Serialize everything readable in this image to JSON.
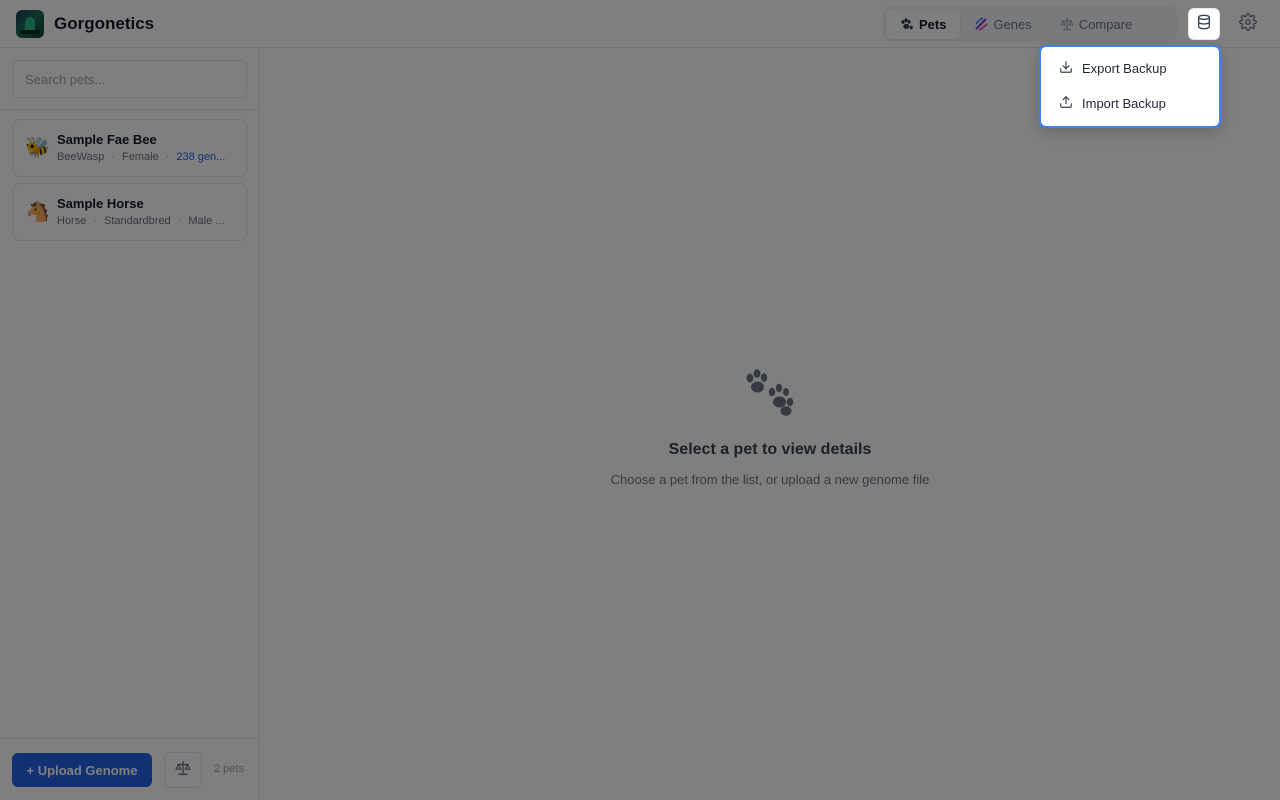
{
  "app": {
    "title": "Gorgonetics"
  },
  "nav": {
    "tabs": [
      {
        "label": "Pets",
        "icon": "paw-icon",
        "active": true
      },
      {
        "label": "Genes",
        "icon": "dna-icon",
        "active": false
      },
      {
        "label": "Compare",
        "icon": "scale-icon",
        "active": false
      }
    ],
    "backup_icon": "database-icon",
    "settings_icon": "gear-icon"
  },
  "sidebar": {
    "search": {
      "placeholder": "Search pets...",
      "value": ""
    },
    "pets": [
      {
        "name": "Sample Fae Bee",
        "emoji": "🐝",
        "species": "BeeWasp",
        "gender": "Female",
        "genes": "238 gen..."
      },
      {
        "name": "Sample Horse",
        "emoji": "🐴",
        "species": "Horse",
        "breed": "Standardbred",
        "gender": "Male ..."
      }
    ],
    "upload_label": "+ Upload Genome",
    "pet_count": "2 pets"
  },
  "main": {
    "empty_title": "Select a pet to view details",
    "empty_subtitle": "Choose a pet from the list, or upload a new genome file"
  },
  "dropdown": {
    "items": [
      {
        "label": "Export Backup",
        "icon": "download-icon"
      },
      {
        "label": "Import Backup",
        "icon": "upload-icon"
      }
    ]
  },
  "colors": {
    "accent": "#2563eb",
    "focus_ring": "#3b82f6",
    "overlay": "rgba(0,0,0,0.5)"
  }
}
